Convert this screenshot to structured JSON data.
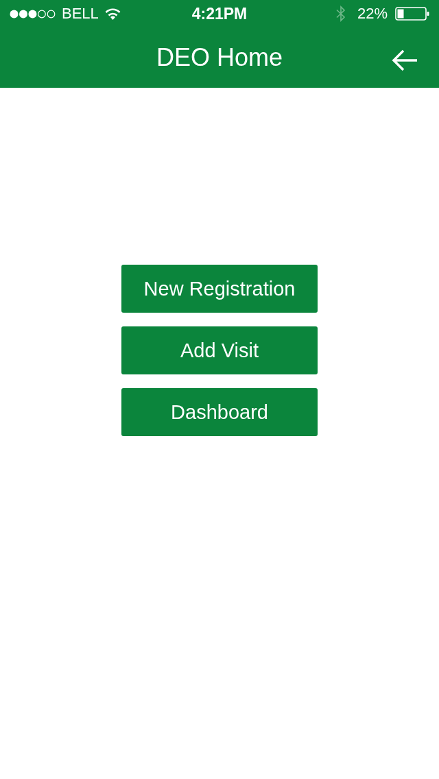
{
  "status_bar": {
    "carrier": "BELL",
    "time": "4:21PM",
    "battery": "22%"
  },
  "header": {
    "title": "DEO Home"
  },
  "buttons": [
    {
      "label": "New Registration"
    },
    {
      "label": "Add Visit"
    },
    {
      "label": "Dashboard"
    }
  ]
}
